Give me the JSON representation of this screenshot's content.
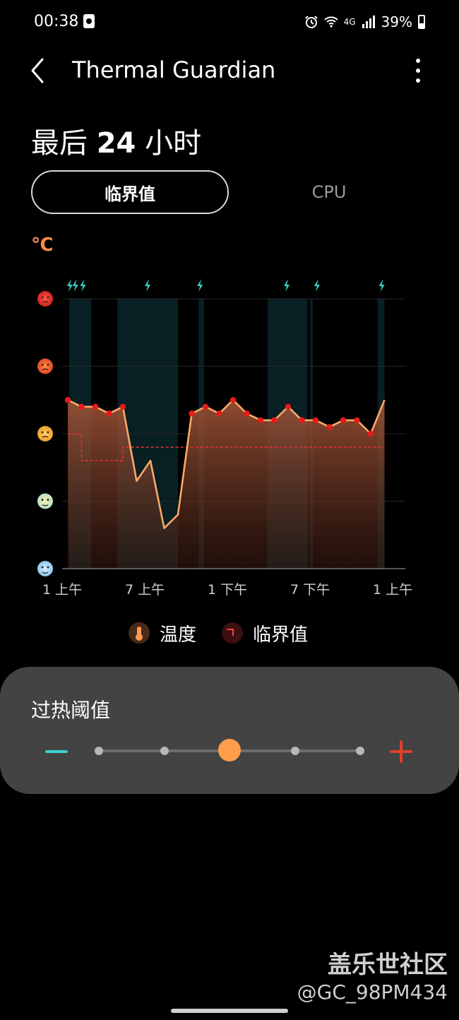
{
  "status_bar": {
    "time": "00:38",
    "network": "4G",
    "battery": "39%"
  },
  "app_bar": {
    "title": "Thermal Guardian"
  },
  "period": {
    "prefix": "最后",
    "hours": "24",
    "suffix": "小时"
  },
  "tabs": [
    {
      "label": "临界值",
      "active": true
    },
    {
      "label": "CPU",
      "active": false
    }
  ],
  "unit": "℃",
  "legend": {
    "temperature": "温度",
    "critical": "临界值"
  },
  "threshold": {
    "title": "过热阈值",
    "steps": 5,
    "selected_step": 2
  },
  "colors": {
    "temperature_line": "#ffa868",
    "critical_line": "#e03030",
    "accent_minus": "#3ad1d1",
    "accent_plus": "#e0402a",
    "thumb": "#ff9d4a"
  },
  "chart_data": {
    "type": "line",
    "x_tick_labels": [
      "1 上午",
      "7 上午",
      "1 下午",
      "7 下午",
      "1 上午"
    ],
    "x_ticks": [
      0,
      6,
      12,
      18,
      24
    ],
    "xlim": [
      0,
      24
    ],
    "y_levels": [
      "hot-face-icon",
      "angry-face-icon",
      "concerned-face-icon",
      "relieved-face-icon",
      "cold-face-icon"
    ],
    "ylim": [
      0,
      4
    ],
    "series": [
      {
        "key": "temperature",
        "points": [
          [
            0,
            2.5
          ],
          [
            1,
            2.4
          ],
          [
            2,
            2.4
          ],
          [
            3,
            2.3
          ],
          [
            4,
            2.4
          ],
          [
            5,
            1.3
          ],
          [
            6,
            1.6
          ],
          [
            7,
            0.6
          ],
          [
            8,
            0.8
          ],
          [
            9,
            2.3
          ],
          [
            10,
            2.4
          ],
          [
            11,
            2.3
          ],
          [
            12,
            2.5
          ],
          [
            13,
            2.3
          ],
          [
            14,
            2.2
          ],
          [
            15,
            2.2
          ],
          [
            16,
            2.4
          ],
          [
            17,
            2.2
          ],
          [
            18,
            2.2
          ],
          [
            19,
            2.1
          ],
          [
            20,
            2.2
          ],
          [
            21,
            2.2
          ],
          [
            22,
            2.0
          ],
          [
            23,
            2.5
          ]
        ],
        "markers": [
          0,
          1,
          2,
          3,
          4,
          9,
          10,
          11,
          12,
          13,
          14,
          15,
          16,
          17,
          18,
          19,
          20,
          21,
          22
        ]
      },
      {
        "key": "critical",
        "step_points": [
          [
            0,
            2.0
          ],
          [
            1,
            2.0
          ],
          [
            1,
            1.6
          ],
          [
            4,
            1.6
          ],
          [
            4,
            1.8
          ],
          [
            23,
            1.8
          ]
        ]
      }
    ],
    "highlight_bands": [
      [
        0.1,
        1.7
      ],
      [
        3.6,
        8
      ],
      [
        9.5,
        9.9
      ],
      [
        14.5,
        17.4
      ],
      [
        17.6,
        17.8
      ],
      [
        22.5,
        23
      ]
    ],
    "bolt_marks": [
      0.15,
      0.55,
      1.1,
      5.8,
      9.6,
      15.9,
      18.1,
      22.8
    ]
  },
  "watermark": {
    "line1": "盖乐世社区",
    "line2": "@GC_98PM434"
  }
}
